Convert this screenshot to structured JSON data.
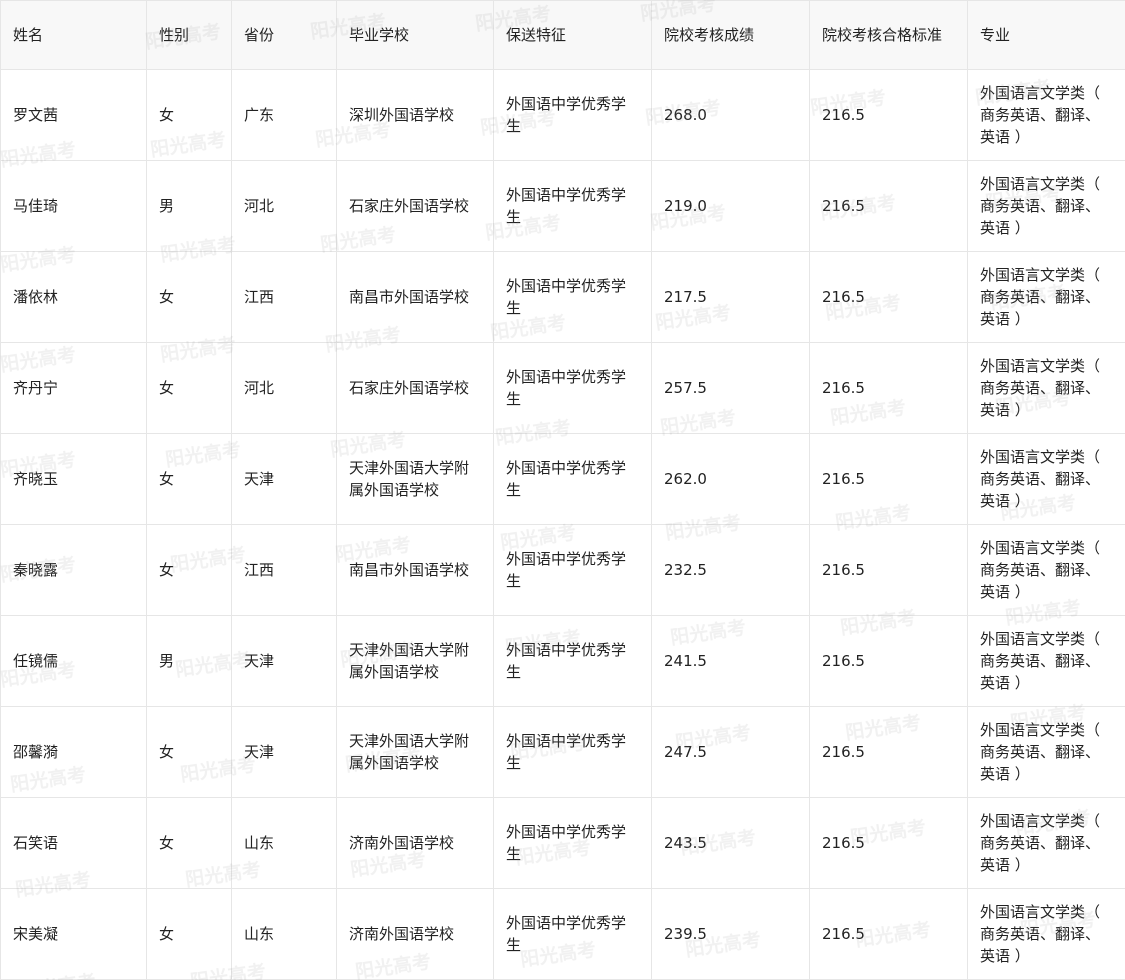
{
  "table": {
    "headers": [
      "姓名",
      "性别",
      "省份",
      "毕业学校",
      "保送特征",
      "院校考核成绩",
      "院校考核合格标准",
      "专业"
    ],
    "rows": [
      [
        "罗文茜",
        "女",
        "广东",
        "深圳外国语学校",
        "外国语中学优秀学生",
        "268.0",
        "216.5",
        "外国语言文学类（ 商务英语、翻译、英语 ）"
      ],
      [
        "马佳琦",
        "男",
        "河北",
        "石家庄外国语学校",
        "外国语中学优秀学生",
        "219.0",
        "216.5",
        "外国语言文学类（ 商务英语、翻译、英语 ）"
      ],
      [
        "潘依林",
        "女",
        "江西",
        "南昌市外国语学校",
        "外国语中学优秀学生",
        "217.5",
        "216.5",
        "外国语言文学类（ 商务英语、翻译、英语 ）"
      ],
      [
        "齐丹宁",
        "女",
        "河北",
        "石家庄外国语学校",
        "外国语中学优秀学生",
        "257.5",
        "216.5",
        "外国语言文学类（ 商务英语、翻译、英语 ）"
      ],
      [
        "齐晓玉",
        "女",
        "天津",
        "天津外国语大学附属外国语学校",
        "外国语中学优秀学生",
        "262.0",
        "216.5",
        "外国语言文学类（ 商务英语、翻译、英语 ）"
      ],
      [
        "秦晓露",
        "女",
        "江西",
        "南昌市外国语学校",
        "外国语中学优秀学生",
        "232.5",
        "216.5",
        "外国语言文学类（ 商务英语、翻译、英语 ）"
      ],
      [
        "任镜儒",
        "男",
        "天津",
        "天津外国语大学附属外国语学校",
        "外国语中学优秀学生",
        "241.5",
        "216.5",
        "外国语言文学类（ 商务英语、翻译、英语 ）"
      ],
      [
        "邵馨漪",
        "女",
        "天津",
        "天津外国语大学附属外国语学校",
        "外国语中学优秀学生",
        "247.5",
        "216.5",
        "外国语言文学类（ 商务英语、翻译、英语 ）"
      ],
      [
        "石笑语",
        "女",
        "山东",
        "济南外国语学校",
        "外国语中学优秀学生",
        "243.5",
        "216.5",
        "外国语言文学类（ 商务英语、翻译、英语 ）"
      ],
      [
        "宋美凝",
        "女",
        "山东",
        "济南外国语学校",
        "外国语中学优秀学生",
        "239.5",
        "216.5",
        "外国语言文学类（ 商务英语、翻译、英语 ）"
      ]
    ]
  },
  "watermark": {
    "text": "阳光高考"
  },
  "colors": {
    "border": "#e6e6e6",
    "header_bg": "#f8f8f8",
    "text": "#222222"
  }
}
